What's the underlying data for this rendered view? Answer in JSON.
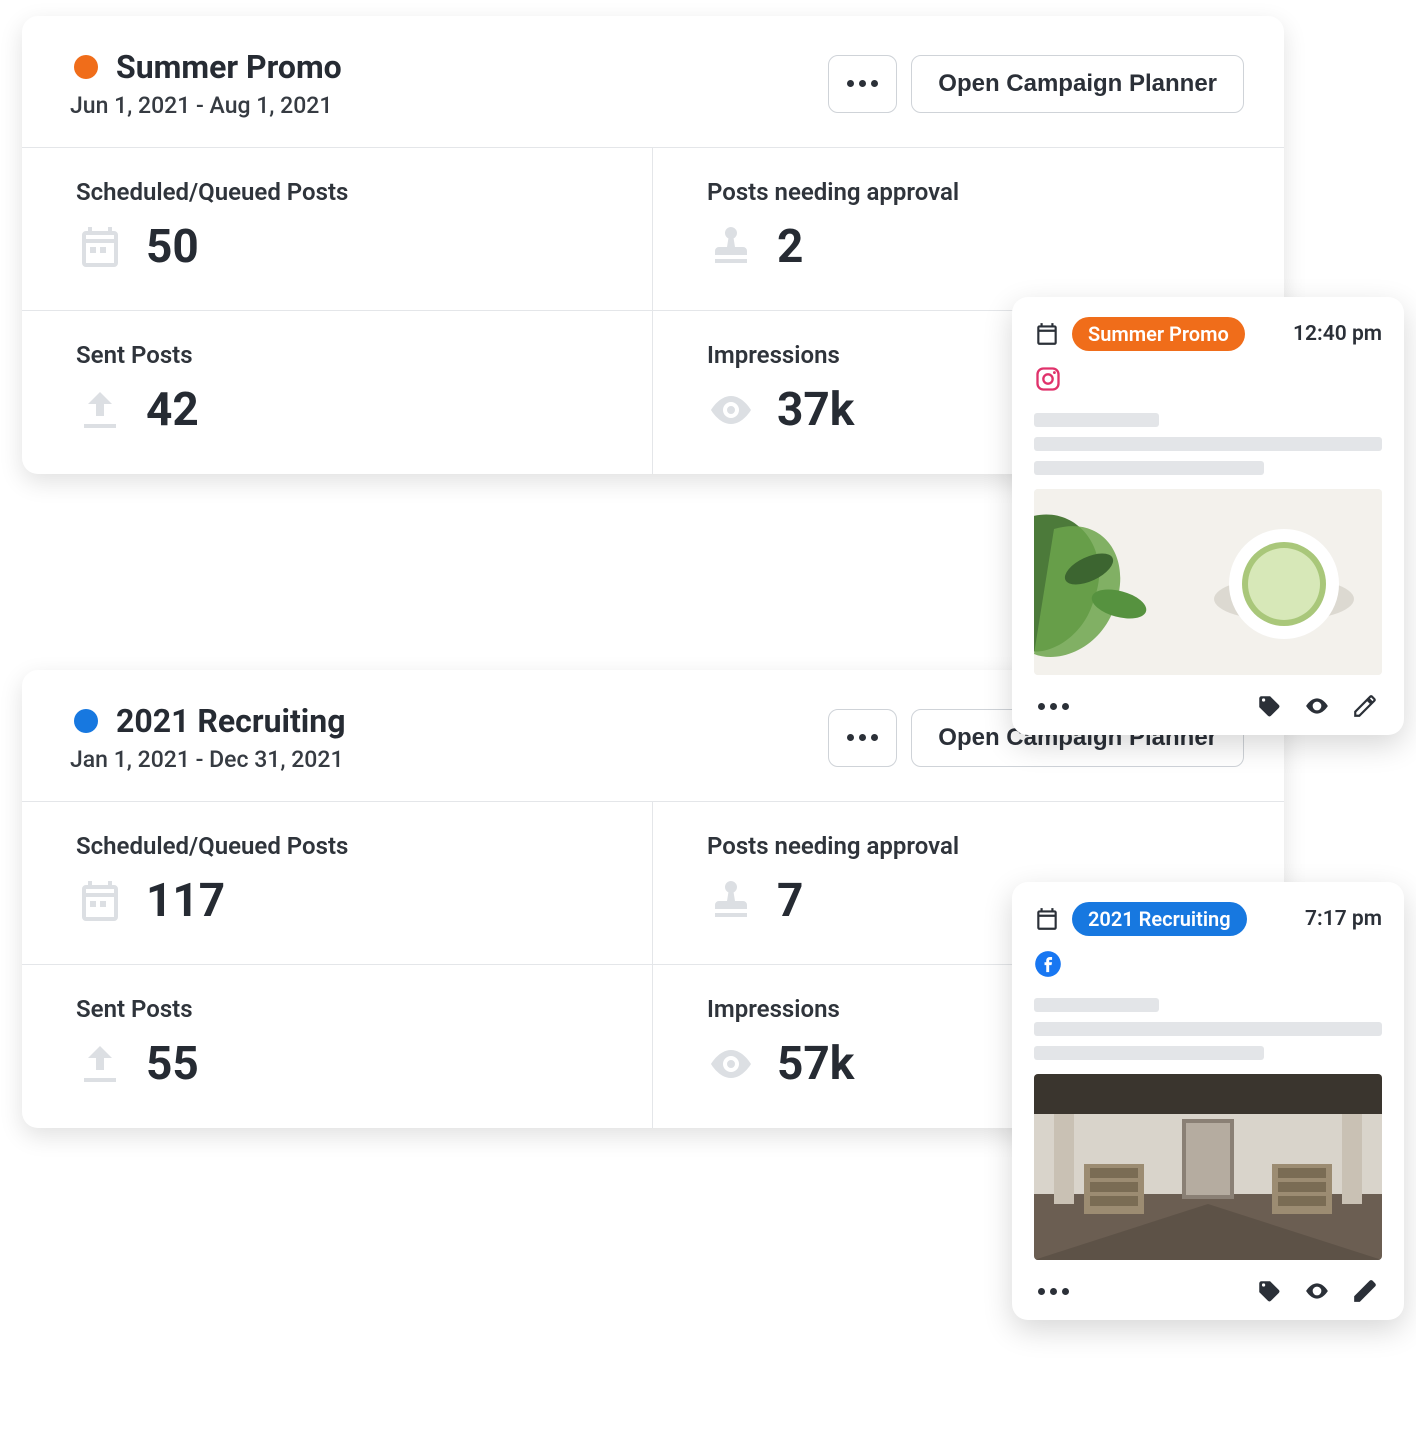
{
  "campaigns": [
    {
      "title": "Summer Promo",
      "dates": "Jun 1, 2021 - Aug 1, 2021",
      "color": "#f06d1a",
      "open_label": "Open Campaign Planner",
      "metrics": {
        "scheduled_label": "Scheduled/Queued Posts",
        "scheduled_value": "50",
        "approval_label": "Posts needing approval",
        "approval_value": "2",
        "sent_label": "Sent Posts",
        "sent_value": "42",
        "impressions_label": "Impressions",
        "impressions_value": "37k"
      }
    },
    {
      "title": "2021 Recruiting",
      "dates": "Jan 1, 2021 - Dec 31, 2021",
      "color": "#1778e0",
      "open_label": "Open Campaign Planner",
      "metrics": {
        "scheduled_label": "Scheduled/Queued Posts",
        "scheduled_value": "117",
        "approval_label": "Posts needing approval",
        "approval_value": "7",
        "sent_label": "Sent Posts",
        "sent_value": "55",
        "impressions_label": "Impressions",
        "impressions_value": "57k"
      }
    }
  ],
  "posts": [
    {
      "badge": "Summer Promo",
      "badge_color": "#f06d1a",
      "time": "12:40 pm",
      "network": "instagram"
    },
    {
      "badge": "2021 Recruiting",
      "badge_color": "#1778e0",
      "time": "7:17 pm",
      "network": "facebook"
    }
  ]
}
